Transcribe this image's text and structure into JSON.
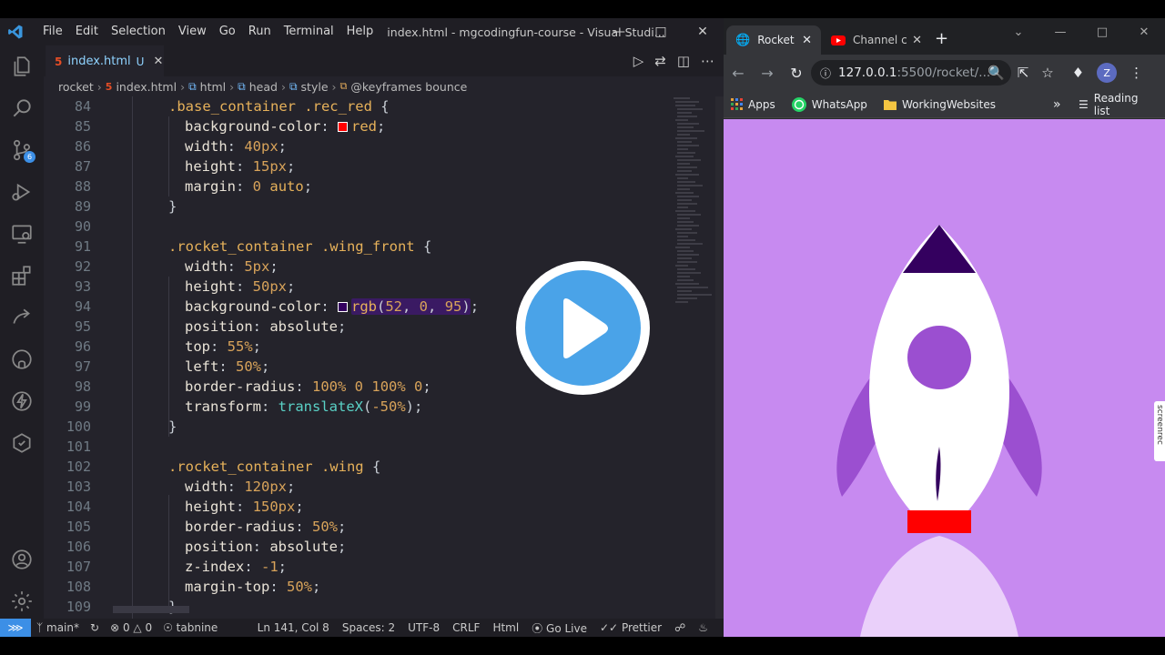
{
  "vscode": {
    "menu": [
      "File",
      "Edit",
      "Selection",
      "View",
      "Go",
      "Run",
      "Terminal",
      "Help"
    ],
    "window_title": "index.html - mgcodingfun-course - Visual Studi...",
    "tab": {
      "name": "index.html",
      "status": "U"
    },
    "source_control_badge": "6",
    "breadcrumbs": [
      "rocket",
      "index.html",
      "html",
      "head",
      "style",
      "@keyframes bounce"
    ],
    "code_lines": [
      {
        "n": "84"
      },
      {
        "n": "85"
      },
      {
        "n": "86"
      },
      {
        "n": "87"
      },
      {
        "n": "88"
      },
      {
        "n": "89"
      },
      {
        "n": "90"
      },
      {
        "n": "91"
      },
      {
        "n": "92"
      },
      {
        "n": "93"
      },
      {
        "n": "94"
      },
      {
        "n": "95"
      },
      {
        "n": "96"
      },
      {
        "n": "97"
      },
      {
        "n": "98"
      },
      {
        "n": "99"
      },
      {
        "n": "100"
      },
      {
        "n": "101"
      },
      {
        "n": "102"
      },
      {
        "n": "103"
      },
      {
        "n": "104"
      },
      {
        "n": "105"
      },
      {
        "n": "106"
      },
      {
        "n": "107"
      },
      {
        "n": "108"
      },
      {
        "n": "109"
      }
    ],
    "status": {
      "branch": "main*",
      "errors": "0",
      "warnings": "0",
      "tabnine": "tabnine",
      "position": "Ln 141, Col 8",
      "spaces": "Spaces: 2",
      "encoding": "UTF-8",
      "eol": "CRLF",
      "language": "Html",
      "golive": "Go Live",
      "prettier": "Prettier"
    },
    "colors": {
      "red_swatch": "#ff0000",
      "purple_swatch": "#34005f"
    }
  },
  "chrome": {
    "tabs": [
      {
        "title": "Rocket"
      },
      {
        "title": "Channel c"
      }
    ],
    "address": {
      "host": "127.0.0.1",
      "rest": ":5500/rocket/..."
    },
    "profile_initial": "Z",
    "bookmarks": [
      "Apps",
      "WhatsApp",
      "WorkingWebsites"
    ],
    "reading_list": "Reading list",
    "overflow": "»",
    "page_bg": "#c78af0",
    "rocket_colors": {
      "body": "#ffffff",
      "nose": "#34005f",
      "window": "#9b4fd0",
      "wing": "#9b4fd0",
      "base": "#ff0000",
      "flame": "#ead0fa"
    }
  },
  "overlay": {
    "screenrec": "screenrec"
  }
}
